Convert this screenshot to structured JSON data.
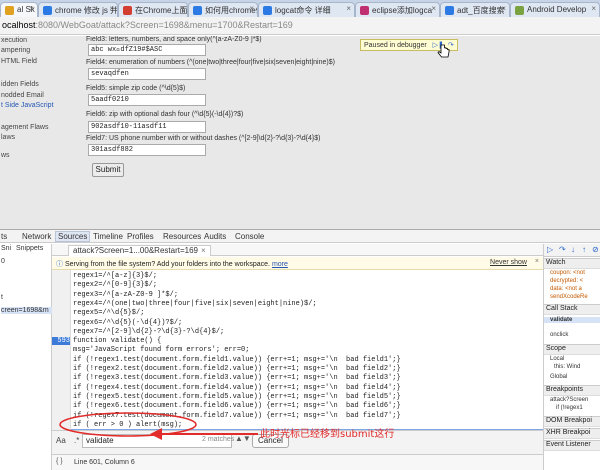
{
  "browser": {
    "tabs": [
      {
        "label": "al Sk",
        "active": true,
        "color": "#e0a020"
      },
      {
        "label": "chrome 修改 js 并",
        "active": false,
        "color": "#2c7be5"
      },
      {
        "label": "在Chrome上面纳",
        "active": false,
        "color": "#d23f31"
      },
      {
        "label": "如何用chrome修",
        "active": false,
        "color": "#2c7be5"
      },
      {
        "label": "logcat命令 详细",
        "active": false,
        "color": "#2c7be5"
      },
      {
        "label": "eclipse添加logca",
        "active": false,
        "color": "#c03070"
      },
      {
        "label": "adt_百度搜索",
        "active": false,
        "color": "#2c7be5"
      },
      {
        "label": "Android Develop",
        "active": false,
        "color": "#7aa240"
      }
    ],
    "url_host": "ocalhost",
    "url_rest": ":8080/WebGoat/attack?Screen=1698&menu=1700&Restart=169"
  },
  "page": {
    "left_menu": [
      "xecution",
      "ampering",
      "HTML Field",
      "idden Fields",
      "nodded Email",
      "t Side JavaScript",
      "agement Flaws",
      "laws",
      "ws"
    ],
    "fields": [
      {
        "label": "Field3: letters, numbers, and space only(^[a-zA-Z0-9 ]*$)",
        "value": "abc wx\u0000dfZ19#$ASC"
      },
      {
        "label": "Field4: enumeration of numbers (^(one|two|three|four|five|six|seven|eight|nine)$)",
        "value": "sevaqdfen"
      },
      {
        "label": "Field5: simple zip code (^\\d{5}$)",
        "value": "5aadf0210"
      },
      {
        "label": "Field6: zip with optional dash four (^\\d{5}(-\\d{4})?$)",
        "value": "902asdf10-11asdf11"
      },
      {
        "label": "Field7: US phone number with or without dashes (^[2-9]\\d{2}-?\\d{3}-?\\d{4}$)",
        "value": "301asdf882"
      }
    ],
    "submit_label": "Submit",
    "paused_label": "Paused in debugger"
  },
  "devtools": {
    "tabs": [
      "ts",
      "Network",
      "Sources",
      "Timeline",
      "Profiles",
      "Resources",
      "Audits",
      "Console"
    ],
    "active_tab": "Sources",
    "left_items": [
      "Sni",
      "Snippets",
      "0",
      "",
      "t",
      "",
      "creen=1698&m"
    ],
    "file_tab": "attack?Screen=1...00&Restart=169",
    "info_text": "Serving from the file system? Add your folders into the workspace.",
    "info_more": "more",
    "info_never": "Never show",
    "lines": [
      {
        "num": "",
        "text": "regex1=/^[a-z]{3}$/;"
      },
      {
        "num": "",
        "text": "regex2=/^[0-9]{3}$/;"
      },
      {
        "num": "",
        "text": "regex3=/^[a-zA-Z0-9 ]*$/;"
      },
      {
        "num": "",
        "text": "regex4=/^(one|two|three|four|five|six|seven|eight|nine)$/;"
      },
      {
        "num": "",
        "text": "regex5=/^\\d{5}$/;"
      },
      {
        "num": "",
        "text": "regex6=/^\\d{5}(-\\d{4})?$/;"
      },
      {
        "num": "",
        "text": "regex7=/^[2-9]\\d{2}-?\\d{3}-?\\d{4}$/;"
      },
      {
        "num": "593",
        "text": "function validate() {"
      },
      {
        "num": "",
        "text": "msg='JavaScript found form errors'; err=0;"
      },
      {
        "num": "",
        "text": "if (!regex1.test(document.form.field1.value)) {err+=1; msg+='\\n  bad field1';}"
      },
      {
        "num": "",
        "text": "if (!regex2.test(document.form.field2.value)) {err+=1; msg+='\\n  bad field2';}"
      },
      {
        "num": "",
        "text": "if (!regex3.test(document.form.field3.value)) {err+=1; msg+='\\n  bad field3';}"
      },
      {
        "num": "",
        "text": "if (!regex4.test(document.form.field4.value)) {err+=1; msg+='\\n  bad field4';}"
      },
      {
        "num": "",
        "text": "if (!regex5.test(document.form.field5.value)) {err+=1; msg+='\\n  bad field5';}"
      },
      {
        "num": "",
        "text": "if (!regex6.test(document.form.field6.value)) {err+=1; msg+='\\n  bad field6';}"
      },
      {
        "num": "",
        "text": "if (!regex7.test(document.form.field7.value)) {err+=1; msg+='\\n  bad field7';}"
      },
      {
        "num": "",
        "text": "if ( err > 0 ) alert(msg);"
      },
      {
        "num": "601",
        "text": "else document.form.submit();"
      },
      {
        "num": "",
        "text": "}"
      }
    ],
    "search_value": "validate",
    "search_count": "2 matches",
    "cancel_label": "Cancel",
    "status_text": "Line 601, Column 6",
    "annotation": "此时光标已经移到submit这行",
    "right": {
      "watch": "Watch",
      "watch_items": [
        "coupon: <not",
        "decrypted: <",
        "data: <not a",
        "sendXcodeRe"
      ],
      "call_stack": "Call Stack",
      "stack_items": [
        "validate",
        "onclick"
      ],
      "scope": "Scope",
      "scope_items": [
        "Local",
        "this: Wind",
        "Global"
      ],
      "breakpoints": "Breakpoints",
      "bp_items": [
        "attack?Screen",
        "if (!regex1"
      ],
      "dom_bp": "DOM Breakpoi",
      "xhr_bp": "XHR Breakpoi",
      "event_bp": "Event Listener"
    }
  }
}
